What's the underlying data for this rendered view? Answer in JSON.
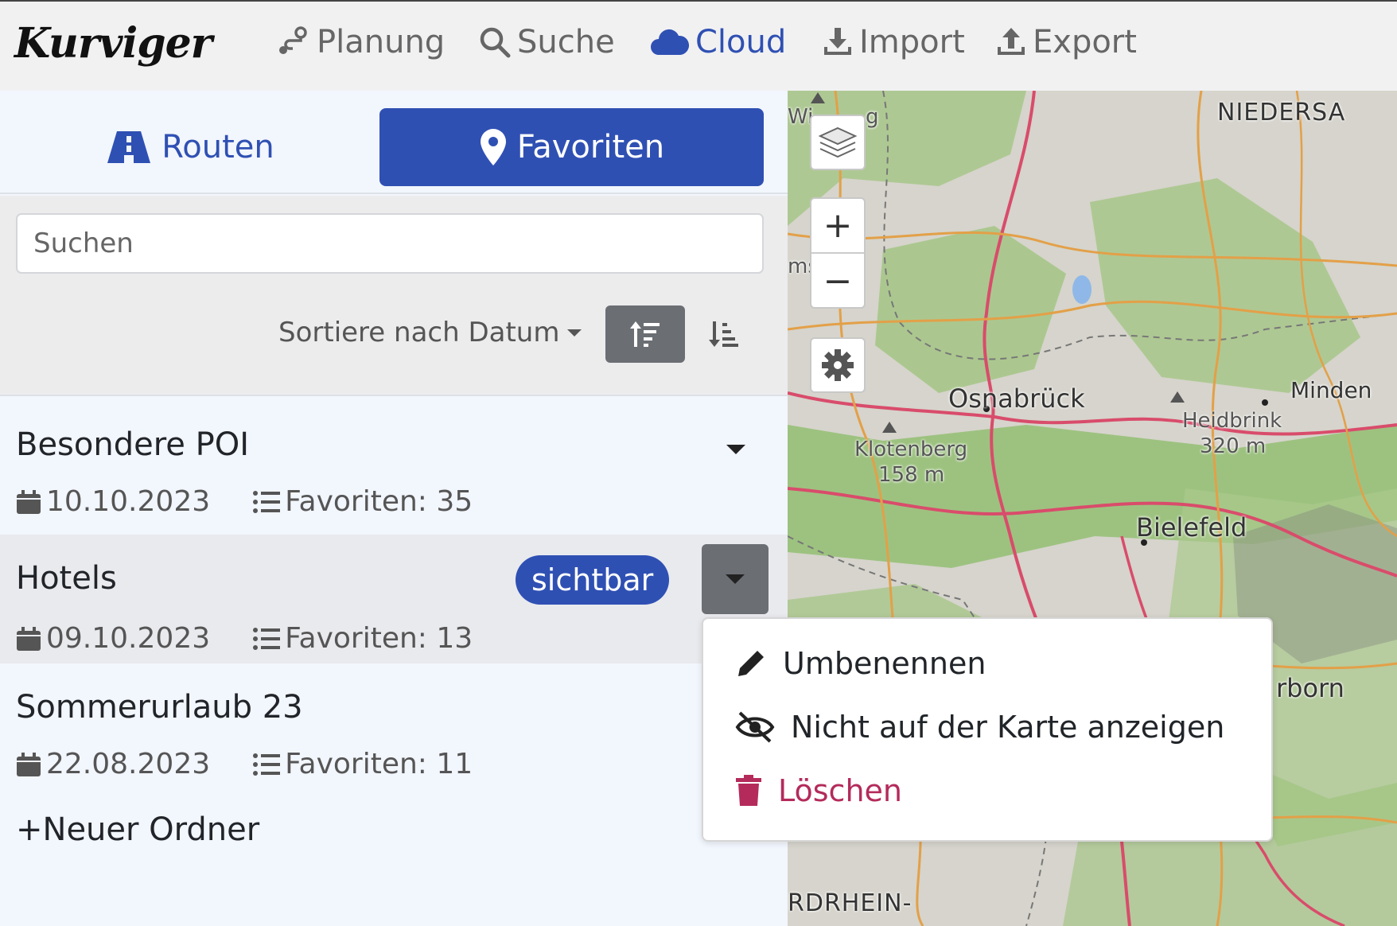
{
  "header": {
    "logo": "Kurviger",
    "nav": [
      {
        "label": "Planung",
        "icon": "route-icon"
      },
      {
        "label": "Suche",
        "icon": "search-icon"
      },
      {
        "label": "Cloud",
        "icon": "cloud-icon",
        "active": true
      },
      {
        "label": "Import",
        "icon": "download-icon"
      },
      {
        "label": "Export",
        "icon": "upload-icon"
      }
    ]
  },
  "sidebar": {
    "tabs": [
      {
        "label": "Routen",
        "icon": "road-icon"
      },
      {
        "label": "Favoriten",
        "icon": "map-pin-icon",
        "active": true
      }
    ],
    "search": {
      "placeholder": "Suchen",
      "value": ""
    },
    "sort": {
      "label": "Sortiere nach Datum"
    },
    "folders": [
      {
        "title": "Besondere POI",
        "date": "10.10.2023",
        "count": "Favoriten: 35"
      },
      {
        "title": "Hotels",
        "date": "09.10.2023",
        "count": "Favoriten: 13",
        "badge": "sichtbar"
      },
      {
        "title": "Sommerurlaub 23",
        "date": "22.08.2023",
        "count": "Favoriten: 11"
      }
    ],
    "new_folder": "+Neuer Ordner"
  },
  "menu": {
    "items": [
      {
        "label": "Umbenennen",
        "icon": "pencil-icon"
      },
      {
        "label": "Nicht auf der Karte anzeigen",
        "icon": "eye-slash-icon"
      },
      {
        "label": "Löschen",
        "icon": "trash-icon",
        "color": "#b42b5b"
      }
    ]
  },
  "map": {
    "labels": {
      "niedersachsen": "NIEDERSA",
      "osnabrueck": "Osnabrück",
      "minden": "Minden",
      "heidbrink": "Heidbrink",
      "heidbrink_height": "320 m",
      "klotenberg": "Klotenberg",
      "klotenberg_height": "158 m",
      "bielefeld": "Bielefeld",
      "paderborn": "rborn",
      "nrw": "RDRHEIN-",
      "edge1": "Wi",
      "edge2": "g",
      "edge3": "ms"
    },
    "zoom_in": "+",
    "zoom_out": "−"
  },
  "colors": {
    "accent": "#2f50b3",
    "danger": "#b42b5b",
    "button_gray": "#6b6f74"
  }
}
